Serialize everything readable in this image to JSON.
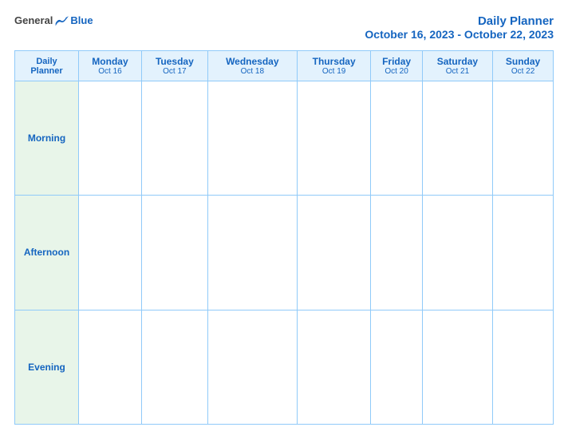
{
  "header": {
    "logo": {
      "general": "General",
      "blue": "Blue"
    },
    "title": "Daily Planner",
    "subtitle": "October 16, 2023 - October 22, 2023"
  },
  "table": {
    "label_header": {
      "line1": "Daily",
      "line2": "Planner"
    },
    "days": [
      {
        "name": "Monday",
        "date": "Oct 16"
      },
      {
        "name": "Tuesday",
        "date": "Oct 17"
      },
      {
        "name": "Wednesday",
        "date": "Oct 18"
      },
      {
        "name": "Thursday",
        "date": "Oct 19"
      },
      {
        "name": "Friday",
        "date": "Oct 20"
      },
      {
        "name": "Saturday",
        "date": "Oct 21"
      },
      {
        "name": "Sunday",
        "date": "Oct 22"
      }
    ],
    "rows": [
      {
        "label": "Morning"
      },
      {
        "label": "Afternoon"
      },
      {
        "label": "Evening"
      }
    ]
  }
}
